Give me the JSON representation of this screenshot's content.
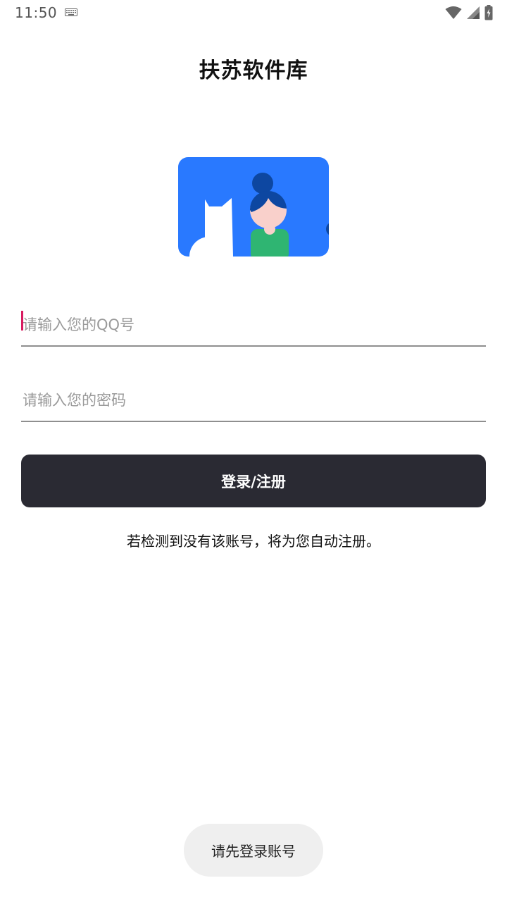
{
  "status_bar": {
    "time": "11:50",
    "icons": [
      "keyboard-icon",
      "wifi-icon",
      "signal-icon",
      "battery-charging-icon"
    ]
  },
  "app": {
    "title": "扶苏软件库"
  },
  "illustration": {
    "name": "login-illustration",
    "background_color": "#2979ff"
  },
  "form": {
    "qq_placeholder": "请输入您的QQ号",
    "qq_value": "",
    "password_placeholder": "请输入您的密码",
    "password_value": "",
    "login_label": "登录/注册",
    "hint": "若检测到没有该账号，将为您自动注册。"
  },
  "toast": {
    "message": "请先登录账号"
  },
  "colors": {
    "button_bg": "#2a2a33",
    "cursor": "#d81b60",
    "underline": "#8f8f8f",
    "placeholder": "#9a9a9a"
  }
}
